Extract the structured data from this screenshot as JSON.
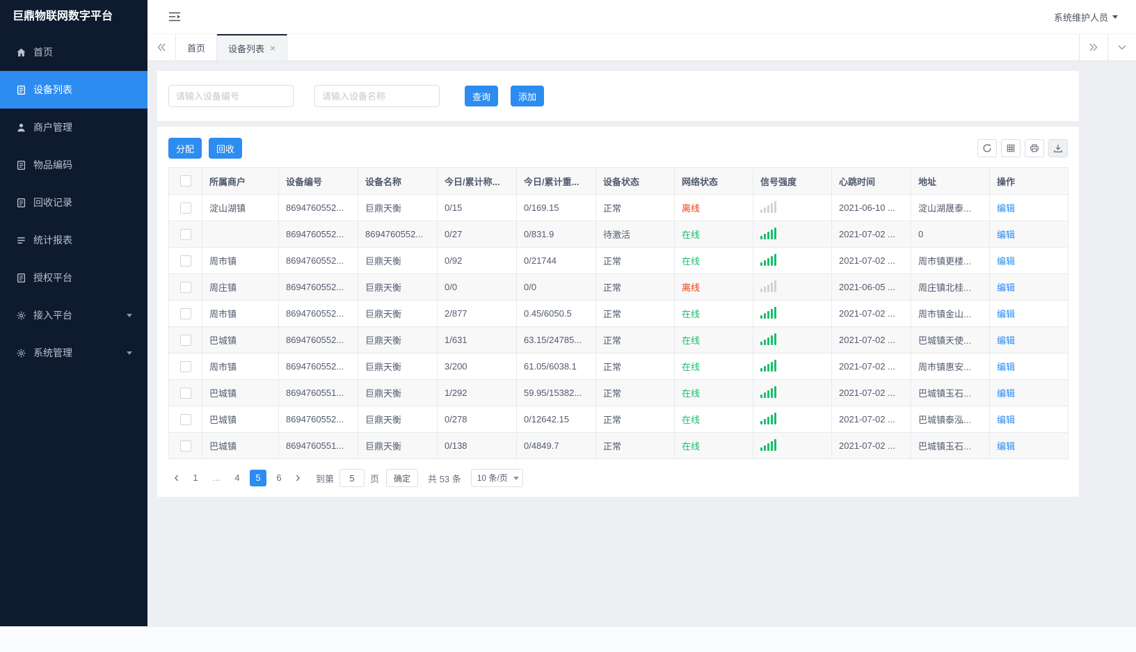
{
  "app": {
    "title": "巨鼎物联网数字平台",
    "user_label": "系统维护人员"
  },
  "colors": {
    "primary": "#2d8cf0",
    "online_green": "#19be6b",
    "offline_red": "#ed4014",
    "sidebar_bg": "#0e1a2e"
  },
  "sidebar": {
    "items": [
      {
        "key": "home",
        "label": "首页",
        "icon": "home-icon",
        "active": false,
        "expandable": false
      },
      {
        "key": "device-list",
        "label": "设备列表",
        "icon": "device-list-icon",
        "active": true,
        "expandable": false
      },
      {
        "key": "merchant-management",
        "label": "商户管理",
        "icon": "merchant-icon",
        "active": false,
        "expandable": false
      },
      {
        "key": "item-code",
        "label": "物品编码",
        "icon": "doc-icon",
        "active": false,
        "expandable": false
      },
      {
        "key": "recycle-record",
        "label": "回收记录",
        "icon": "doc-icon",
        "active": false,
        "expandable": false
      },
      {
        "key": "stats-report",
        "label": "统计报表",
        "icon": "report-lines-icon",
        "active": false,
        "expandable": false
      },
      {
        "key": "auth-platform",
        "label": "授权平台",
        "icon": "doc-icon",
        "active": false,
        "expandable": false
      },
      {
        "key": "access-platform",
        "label": "接入平台",
        "icon": "gear-icon",
        "active": false,
        "expandable": true
      },
      {
        "key": "system-management",
        "label": "系统管理",
        "icon": "gear-icon",
        "active": false,
        "expandable": true
      }
    ]
  },
  "tabbar": {
    "tabs": [
      {
        "key": "home",
        "label": "首页",
        "active": false,
        "closable": false
      },
      {
        "key": "device-list",
        "label": "设备列表",
        "active": true,
        "closable": true
      }
    ]
  },
  "search": {
    "device_no_placeholder": "请输入设备编号",
    "device_name_placeholder": "请输入设备名称",
    "query_label": "查询",
    "add_label": "添加"
  },
  "toolbar": {
    "assign_label": "分配",
    "recycle_label": "回收"
  },
  "table": {
    "headers": [
      "所属商户",
      "设备编号",
      "设备名称",
      "今日/累计称...",
      "今日/累计重...",
      "设备状态",
      "网络状态",
      "信号强度",
      "心跳时间",
      "地址",
      "操作"
    ],
    "edit_label": "编辑",
    "rows": [
      {
        "merchant": "淀山湖镇",
        "device_no": "8694760552...",
        "device_name": "巨鼎天衡",
        "today_count": "0/15",
        "today_weight": "0/169.15",
        "device_status": "正常",
        "network_status": "离线",
        "online": false,
        "heartbeat": "2021-06-10 ...",
        "address": "淀山湖晟泰..."
      },
      {
        "merchant": "",
        "device_no": "8694760552...",
        "device_name": "8694760552...",
        "today_count": "0/27",
        "today_weight": "0/831.9",
        "device_status": "待激活",
        "network_status": "在线",
        "online": true,
        "heartbeat": "2021-07-02 ...",
        "address": "0"
      },
      {
        "merchant": "周市镇",
        "device_no": "8694760552...",
        "device_name": "巨鼎天衡",
        "today_count": "0/92",
        "today_weight": "0/21744",
        "device_status": "正常",
        "network_status": "在线",
        "online": true,
        "heartbeat": "2021-07-02 ...",
        "address": "周市镇更楼..."
      },
      {
        "merchant": "周庄镇",
        "device_no": "8694760552...",
        "device_name": "巨鼎天衡",
        "today_count": "0/0",
        "today_weight": "0/0",
        "device_status": "正常",
        "network_status": "离线",
        "online": false,
        "heartbeat": "2021-06-05 ...",
        "address": "周庄镇北桂..."
      },
      {
        "merchant": "周市镇",
        "device_no": "8694760552...",
        "device_name": "巨鼎天衡",
        "today_count": "2/877",
        "today_weight": "0.45/6050.5",
        "device_status": "正常",
        "network_status": "在线",
        "online": true,
        "heartbeat": "2021-07-02 ...",
        "address": "周市镇金山..."
      },
      {
        "merchant": "巴城镇",
        "device_no": "8694760552...",
        "device_name": "巨鼎天衡",
        "today_count": "1/631",
        "today_weight": "63.15/24785...",
        "device_status": "正常",
        "network_status": "在线",
        "online": true,
        "heartbeat": "2021-07-02 ...",
        "address": "巴城镇天使..."
      },
      {
        "merchant": "周市镇",
        "device_no": "8694760552...",
        "device_name": "巨鼎天衡",
        "today_count": "3/200",
        "today_weight": "61.05/6038.1",
        "device_status": "正常",
        "network_status": "在线",
        "online": true,
        "heartbeat": "2021-07-02 ...",
        "address": "周市镇惠安..."
      },
      {
        "merchant": "巴城镇",
        "device_no": "8694760551...",
        "device_name": "巨鼎天衡",
        "today_count": "1/292",
        "today_weight": "59.95/15382...",
        "device_status": "正常",
        "network_status": "在线",
        "online": true,
        "heartbeat": "2021-07-02 ...",
        "address": "巴城镇玉石..."
      },
      {
        "merchant": "巴城镇",
        "device_no": "8694760552...",
        "device_name": "巨鼎天衡",
        "today_count": "0/278",
        "today_weight": "0/12642.15",
        "device_status": "正常",
        "network_status": "在线",
        "online": true,
        "heartbeat": "2021-07-02 ...",
        "address": "巴城镇泰泓..."
      },
      {
        "merchant": "巴城镇",
        "device_no": "8694760551...",
        "device_name": "巨鼎天衡",
        "today_count": "0/138",
        "today_weight": "0/4849.7",
        "device_status": "正常",
        "network_status": "在线",
        "online": true,
        "heartbeat": "2021-07-02 ...",
        "address": "巴城镇玉石..."
      }
    ]
  },
  "pagination": {
    "pages": [
      {
        "label": "1",
        "active": false,
        "ellipsis": false
      },
      {
        "label": "...",
        "active": false,
        "ellipsis": true
      },
      {
        "label": "4",
        "active": false,
        "ellipsis": false
      },
      {
        "label": "5",
        "active": true,
        "ellipsis": false
      },
      {
        "label": "6",
        "active": false,
        "ellipsis": false
      }
    ],
    "jump_prefix": "到第",
    "jump_value": "5",
    "jump_suffix": "页",
    "confirm_label": "确定",
    "total_label": "共 53 条",
    "page_size_label": "10 条/页"
  }
}
